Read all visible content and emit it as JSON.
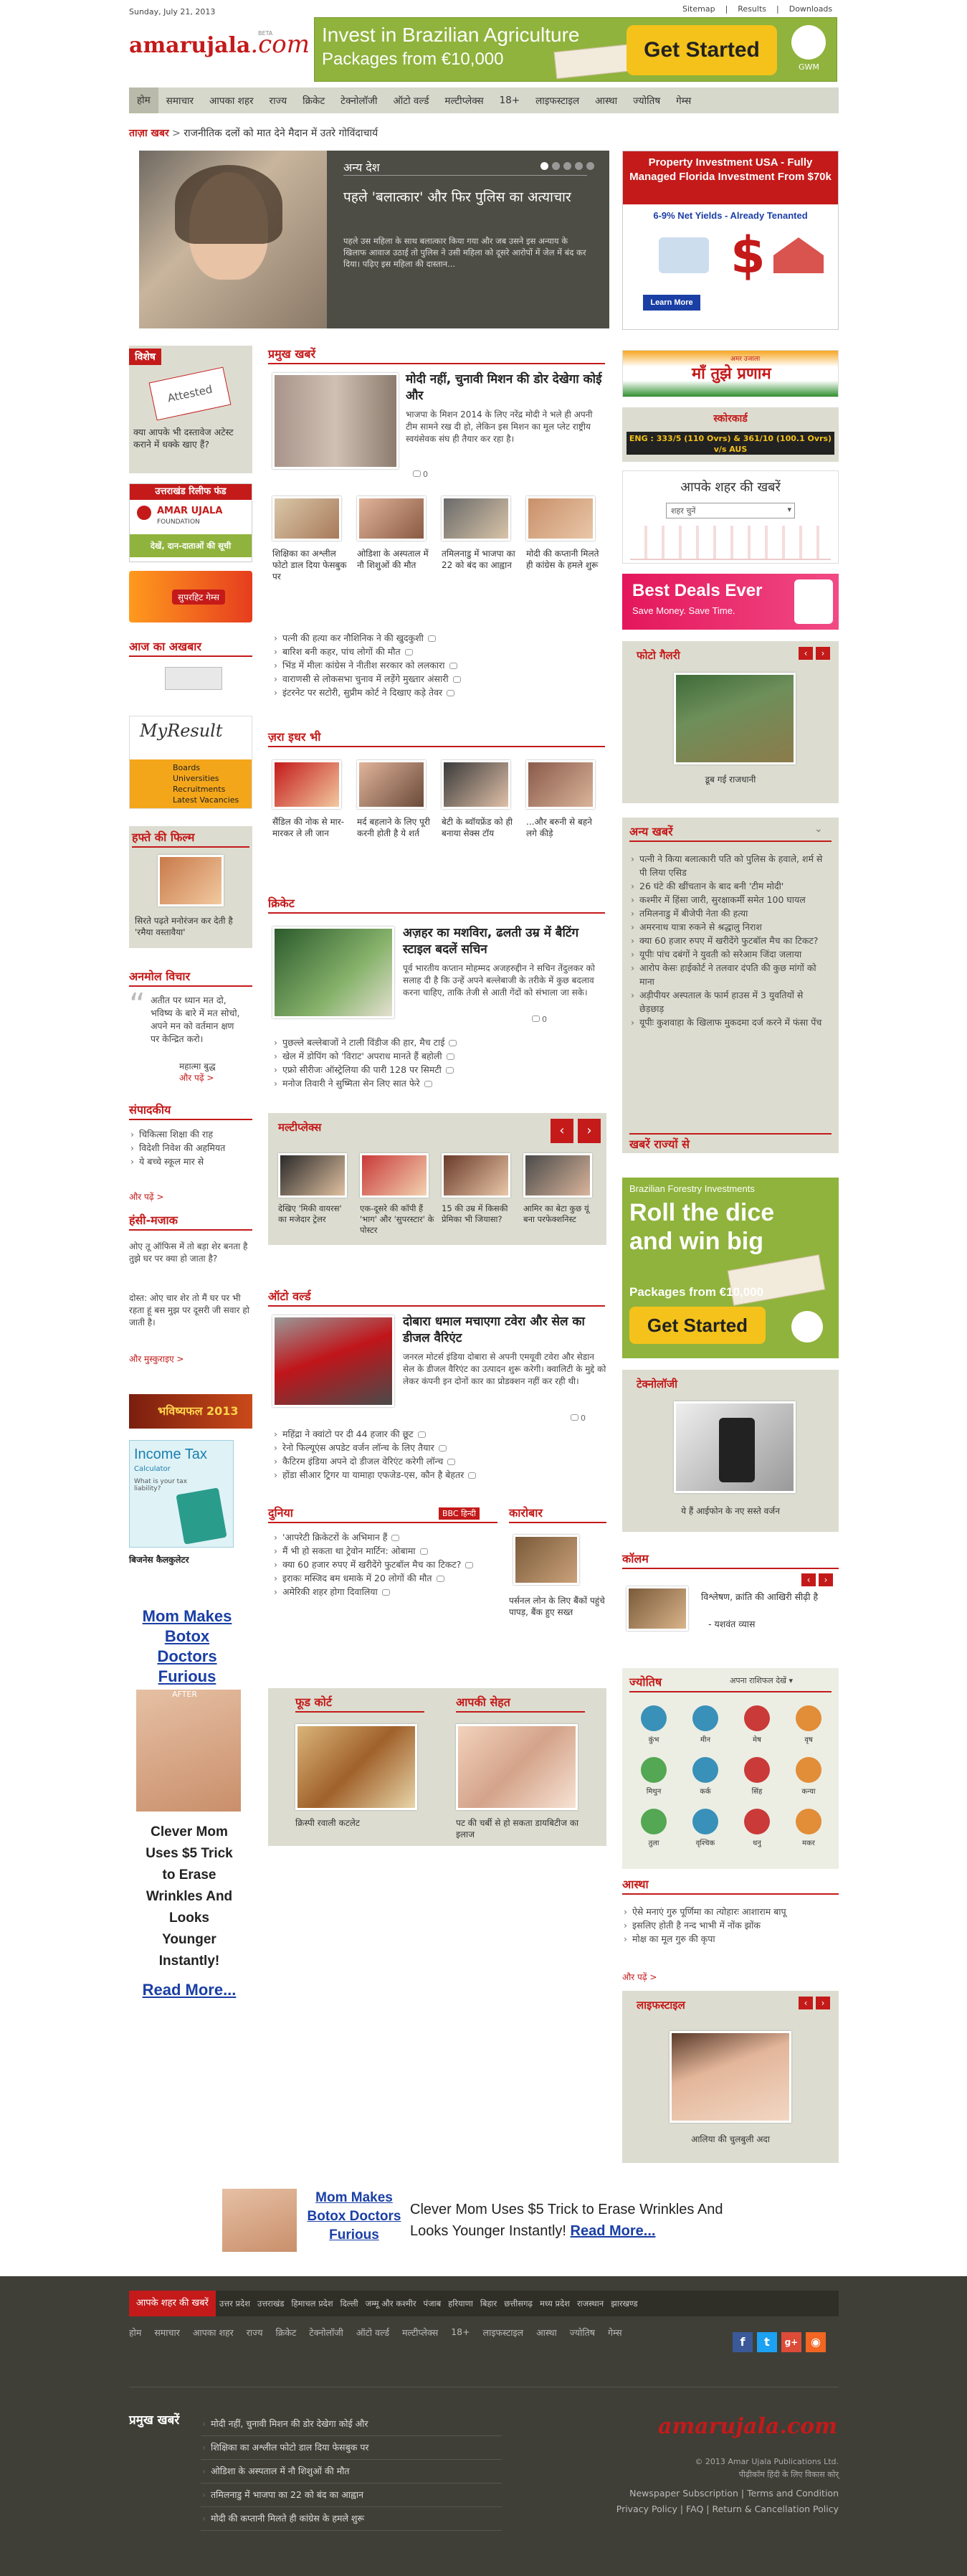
{
  "topbar": {
    "date": "Sunday, July 21, 2013",
    "links": [
      "Sitemap",
      "Results",
      "Downloads"
    ]
  },
  "logo": {
    "name": "amarujala",
    "suffix": ".com",
    "beta": "BETA"
  },
  "ad_top": {
    "line1": "Invest in Brazilian Agriculture",
    "line2": "Packages from €10,000",
    "cta": "Get Started",
    "brand": "GWM"
  },
  "nav": [
    "होम",
    "समाचार",
    "आपका शहर",
    "राज्य",
    "क्रिकेट",
    "टेक्नोलॉजी",
    "ऑटो वर्ल्ड",
    "मल्टीप्लेक्स",
    "18+",
    "लाइफस्टाइल",
    "आस्था",
    "ज्योतिष",
    "गेम्स"
  ],
  "ticker": {
    "label": "ताज़ा खबर",
    "text": "राजनीतिक दलों को मात देने मैदान में उतरे गोविंदाचार्य"
  },
  "hero": {
    "category": "अन्य देश",
    "title": "पहले 'बलात्कार' और फिर पुलिस का अत्याचार",
    "summary": "पहले उस महिला के साथ बलात्कार किया गया और जब उसने इस अन्याय के खिलाफ आवाज उठाई तो पुलिस ने उसी महिला को दूसरे आरोपों में जेल में बंद कर दिया। पढ़िए इस महिला की दास्तान..."
  },
  "ad_right1": {
    "title": "Property Investment USA - Fully Managed Florida Investment From $70k",
    "sub": "6-9% Net Yields - Already Tenanted",
    "btn": "Learn More"
  },
  "vishesh": {
    "header": "विशेष",
    "stamp": "Attested",
    "caption": "क्या आपके भी दस्तावेज अटेस्ट कराने में धक्के खाए हैं?"
  },
  "relief": {
    "header": "उत्तराखंड रिलीफ फंड",
    "org": "AMAR UJALA",
    "org2": "FOUNDATION",
    "sub": "देखें, दान-दाताओं की सूची"
  },
  "superhit": "सुपरहिट गेम्स",
  "aaj": {
    "header": "आज का अखबार"
  },
  "myresult": {
    "logo": "MyResult",
    "items": [
      "Boards",
      "Universities",
      "Recruitments",
      "Latest Vacancies"
    ]
  },
  "film": {
    "header": "हफ्ते की फिल्म",
    "caption": "सिरते पढ़ते मनोरंजन कर देती है 'रमैया वस्तावैया'"
  },
  "anmol": {
    "header": "अनमोल विचार",
    "quote": "अतीत पर ध्यान मत दो, भविष्य के बारे में मत सोचो, अपने मन को वर्तमान क्षण पर केन्द्रित करो।",
    "author": "महात्मा बुद्ध",
    "more": "और पढ़ें >"
  },
  "sampadkiya": {
    "header": "संपादकीय",
    "items": [
      "चिकित्सा शिक्षा की राह",
      "विदेशी निवेश की अहमियत",
      "ये बच्चे स्कूल मार से"
    ],
    "more": "और पढ़ें >"
  },
  "hasi": {
    "header": "हंसी-मजाक",
    "text1": "ओए तू ऑफिस में तो बड़ा शेर बनता है तुझे घर पर क्या हो जाता है?",
    "text2": "दोस्त: ओए चार शेर तो मैं घर पर भी रहता हूं बस मुझ पर दूसरी जी सवार हो जाती है।",
    "more": "और मुस्कुराइए >"
  },
  "bhavishya": "भविष्यफल 2013",
  "incometax": {
    "title": "Income Tax",
    "sub": "Calculator",
    "q": "What is your tax liability?",
    "caption": "बिजनेस कैलकुलेटर"
  },
  "ad_left": {
    "title": "Mom Makes Botox Doctors Furious",
    "after": "AFTER",
    "body": "Clever Mom Uses $5 Trick to Erase Wrinkles And Looks Younger Instantly!",
    "more": "Read More..."
  },
  "pramukh": {
    "header": "प्रमुख खबरें",
    "title": "मोदी नहीं, चुनावी मिशन की डोर देखेगा कोई और",
    "summary": "भाजपा के मिशन 2014 के लिए नरेंद्र मोदी ने भले ही अपनी टीम सामने रख दी हो, लेकिन इस मिशन का मूल प्लेट राष्ट्रीय स्वयंसेवक संघ ही तैयार कर रहा है।",
    "comments": "0",
    "thumbs": [
      "शिक्षिका का अश्लील फोटो डाल दिया फेसबुक पर",
      "ओडिशा के अस्पताल में नौ शिशुओं की मौत",
      "तमिलनाडु में भाजपा का 22 को बंद का आह्वान",
      "मोदी की कप्तानी मिलते ही कांग्रेस के हमले शुरू"
    ],
    "list": [
      "पत्नी की हत्या कर नौशिनिक ने की खुदकुशी",
      "बारिश बनी कहर, पांच लोगों की मौत",
      "भिंड में मीलः कांग्रेस ने नीतीश सरकार को ललकारा",
      "वाराणसी से लोकसभा चुनाव में लड़ेंगे मुख्तार अंसारी",
      "इंटरनेट पर सटोरी, सुप्रीम कोर्ट ने दिखाए कड़े तेवर"
    ]
  },
  "jara": {
    "header": "ज़रा इधर भी",
    "items": [
      "सैंडिल की नोक से मार-मारकर ले ली जान",
      "मर्द बहलाने के लिए पूरी करनी होती है ये शर्त",
      "बेटी के ब्वॉयफ्रेंड को ही बनाया सेक्स टॉय",
      "...और बरुनी से बहने लगे कीड़े"
    ]
  },
  "cricket": {
    "header": "क्रिकेट",
    "title": "अज़हर का मशविरा, ढलती उम्र में बैटिंग स्टाइल बदलें सचिन",
    "summary": "पूर्व भारतीय कप्तान मोहम्मद अजहरुद्दीन ने सचिन तेंदुलकर को सलाह दी है कि उन्हें अपने बल्लेबाजी के तरीके में कुछ बदलाव करना चाहिए, ताकि तेजी से आती गेंदों को संभाला जा सके।",
    "comments": "0",
    "list": [
      "पुछल्ले बल्लेबाजों ने टाली विंडीज की हार, मैच टाई",
      "खेल में डोपिंग को 'विराट' अपराध मानते हैं बहोली",
      "एफ्रो सीरीजः ऑस्ट्रेलिया की पारी 128 पर सिमटी",
      "मनोज तिवारी ने सुष्मिता सेन लिए सात फेरे"
    ]
  },
  "multiplex": {
    "header": "मल्टीप्लेक्स",
    "items": [
      "देखिए 'मिकी वायरस' का मजेदार ट्रेलर",
      "एक-दूसरे की कॉपी हैं 'भाग' और 'सुपरस्टार' के पोस्टर",
      "15 की उम्र में किसकी प्रेमिका भी जियासा?",
      "आमिर का बेटा कुछ यूं बना परफेक्शनिस्ट"
    ]
  },
  "auto": {
    "header": "ऑटो वर्ल्ड",
    "title": "दोबारा धमाल मचाएगा टवेरा और सेल का डीजल वैरिएंट",
    "summary": "जनरल मोटर्स इंडिया दोबारा से अपनी एमयूवी टवेरा और सेडान सेल के डीजल वैरिएंट का उत्पादन शुरू करेगी। क्वालिटी के मुद्दे को लेकर कंपनी इन दोनों कार का प्रोडक्शन नहीं कर रही थी।",
    "comments": "0",
    "list": [
      "महिंद्रा ने क्वांटो पर दी 44 हजार की छूट",
      "रेनो फिल्यूएंस अपडेट वर्जन लॉन्च के लिए तैयार",
      "कैटिरम इंडिया अपने दो डीजल वेरिएंट करेगी लॉन्च",
      "होंडा सीआर ट्रिगर या यामाहा एफजेड-एस, कौन है बेहतर"
    ]
  },
  "duniya": {
    "header": "दुनिया",
    "bbc": "BBC हिन्दी",
    "items": [
      "'आपरेटी क्रिकेटरों के अभिमान हैं",
      "मैं भी हो सकता था ट्रेवोन मार्टिन: ओबामा",
      "क्या 60 हजार रुपए में खरीदेंगे फुटबॉल मैच का टिकट?",
      "इराकः मस्जिद बम धमाके में 20 लोगों की मौत",
      "अमेरिकी शहर होगा दिवालिया"
    ]
  },
  "karobar": {
    "header": "कारोबार",
    "caption": "पर्सनल लोन के लिए बैंकों पहुंचे पापड़, बैंक हुए सख्त"
  },
  "food": {
    "header": "फूड कोर्ट",
    "caption": "क्रिस्पी रवाली कटलेट"
  },
  "sehat": {
    "header": "आपकी सेहत",
    "caption": "पट की चर्बी से हो सकता डायबिटीज का इलाज"
  },
  "maa": {
    "title": "माँ तुझे प्रणाम",
    "sub": "अमर उजाला"
  },
  "score": {
    "header": "स्कोरकार्ड",
    "text": "ENG : 333/5 (110 Ovrs) & 361/10 (100.1 Ovrs) v/s AUS"
  },
  "city": {
    "title": "आपके शहर की खबरें",
    "select": "शहर चुनें"
  },
  "bestdeals": {
    "title": "Best Deals Ever",
    "sub": "Save Money. Save Time."
  },
  "photo": {
    "header": "फोटो गैलरी",
    "caption": "डूब गई राजधानी"
  },
  "anya": {
    "header": "अन्य खबरें",
    "items": [
      "पत्नी ने किया बलात्कारी पति को पुलिस के हवाले, शर्म से पी लिया एसिड",
      "26 घंटे की खींचतान के बाद बनी 'टीम मोदी'",
      "कश्मीर में हिंसा जारी, सुरक्षाकर्मी समेत 100 घायल",
      "तमिलनाडु में बीजेपी नेता की हत्या",
      "अमरनाथ यात्रा रुकने से श्रद्धालु निराश",
      "क्या 60 हजार रुपए में खरीदेंगे फुटबॉल मैच का टिकट?",
      "यूपीः पांच दबंगों ने युवती को सरेआम जिंदा जलाया",
      "आरोप केसः हाईकोर्ट ने तलवार दंपति की कुछ मांगों को माना",
      "अड़ीपीयर अस्पताल के फार्म हाउस में 3 युवतियों से छेड़छाड़",
      "यूपीः कुशवाहा के खिलाफ मुकदमा दर्ज करने में फंसा पेंच"
    ]
  },
  "rajyon": {
    "header": "खबरें राज्यों से"
  },
  "ad_right2": {
    "top": "Brazilian Forestry Investments",
    "line1": "Roll the dice",
    "line2": "and win big",
    "line3": "Packages from €10,000",
    "cta": "Get Started",
    "brand": "GWM"
  },
  "tech": {
    "header": "टेक्नोलॉजी",
    "caption": "ये हैं आईफोन के नए सस्ते वर्जन"
  },
  "column": {
    "header": "कॉलम",
    "caption": "विश्लेषण, क्रांति की आखिरी सीढ़ी है",
    "author": "- यशवंत व्यास"
  },
  "jyotish": {
    "header": "ज्योतिष",
    "select": "अपना राशिफल देखें",
    "signs": [
      "कुंभ",
      "मीन",
      "मेष",
      "वृष",
      "मिथुन",
      "कर्क",
      "सिंह",
      "कन्या",
      "तुला",
      "वृश्चिक",
      "धनु",
      "मकर"
    ]
  },
  "astha": {
    "header": "आस्था",
    "items": [
      "ऐसे मनाएं गुरु पूर्णिमा का त्योहारः आशाराम बापू",
      "इसलिए होती है नन्द भाभी में नोंक झोंक",
      "मोक्ष का मूल गुरु की कृपा"
    ],
    "more": "और पढ़ें >"
  },
  "lifestyle": {
    "header": "लाइफस्टाइल",
    "caption": "आलिया की चुलबुली अदा"
  },
  "ad_bottom": {
    "title": "Mom Makes Botox Doctors Furious",
    "body": "Clever Mom Uses $5 Trick to Erase Wrinkles And Looks Younger Instantly!",
    "more": "Read More..."
  },
  "footer": {
    "states_label": "आपके शहर की खबरें",
    "states": [
      "उत्तर प्रदेश",
      "उत्तराखंड",
      "हिमाचल प्रदेश",
      "दिल्ली",
      "जम्मू और कश्मीर",
      "पंजाब",
      "हरियाणा",
      "बिहार",
      "छत्तीसगढ़",
      "मध्य प्रदेश",
      "राजस्थान",
      "झारखण्ड"
    ],
    "nav": [
      "होम",
      "समाचार",
      "आपका शहर",
      "राज्य",
      "क्रिकेट",
      "टेक्नोलॉजी",
      "ऑटो वर्ल्ड",
      "मल्टीप्लेक्स",
      "18+",
      "लाइफस्टाइल",
      "आस्था",
      "ज्योतिष",
      "गेम्स"
    ],
    "pramukh_label": "प्रमुख खबरें",
    "pramukh": [
      "मोदी नहीं, चुनावी मिशन की डोर देखेगा कोई और",
      "शिक्षिका का अश्लील फोटो डाल दिया फेसबुक पर",
      "ओडिशा के अस्पताल में नौ शिशुओं की मौत",
      "तमिलनाडु में भाजपा का 22 को बंद का आह्वान",
      "मोदी की कप्तानी मिलते ही कांग्रेस के हमले शुरू"
    ],
    "copy": "© 2013 Amar Ujala Publications Ltd.",
    "copy2": "पीढ़ीकॉम हिंदी के लिए विकास कोर्",
    "links1": "Newspaper Subscription  |  Terms and Condition",
    "links2": "Privacy Policy  |  FAQ  |  Return & Cancellation Policy"
  },
  "colors": {
    "red": "#c41a1a",
    "greenbox": "#dcddd0",
    "footer": "#3f3f37",
    "ad_green": "#8fb33c",
    "ad_yellow": "#f4c21a"
  }
}
